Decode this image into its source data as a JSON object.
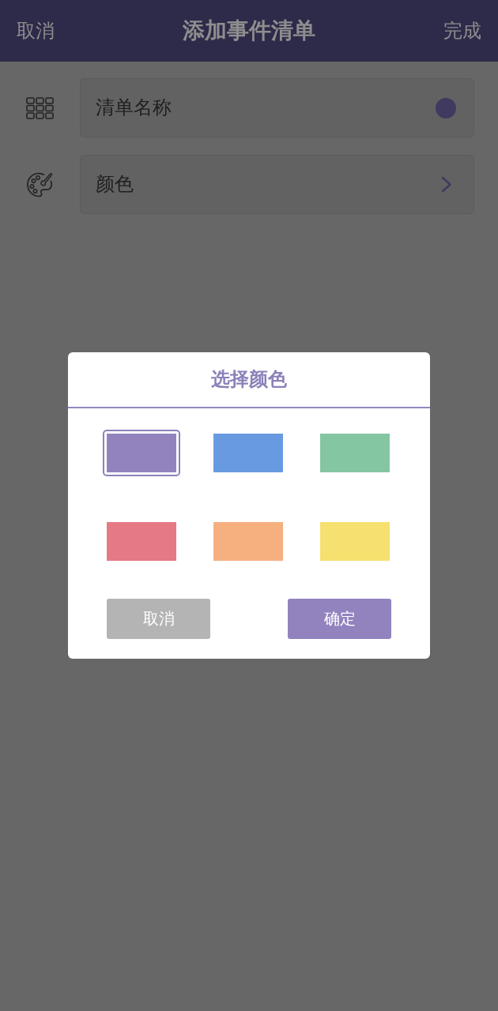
{
  "header": {
    "cancel": "取消",
    "title": "添加事件清单",
    "done": "完成"
  },
  "fields": [
    {
      "kind": "name",
      "label": "清单名称",
      "color": "#403a60"
    },
    {
      "kind": "color",
      "label": "颜色"
    }
  ],
  "dialog": {
    "title": "选择颜色",
    "swatches": [
      {
        "color": "#9283bf",
        "selected": true
      },
      {
        "color": "#689ae2",
        "selected": false
      },
      {
        "color": "#84c6a1",
        "selected": false
      },
      {
        "color": "#e57985",
        "selected": false
      },
      {
        "color": "#f6af7f",
        "selected": false
      },
      {
        "color": "#f6e06f",
        "selected": false
      }
    ],
    "buttons": [
      {
        "kind": "cancel",
        "label": "取消"
      },
      {
        "kind": "confirm",
        "label": "确定"
      }
    ]
  }
}
